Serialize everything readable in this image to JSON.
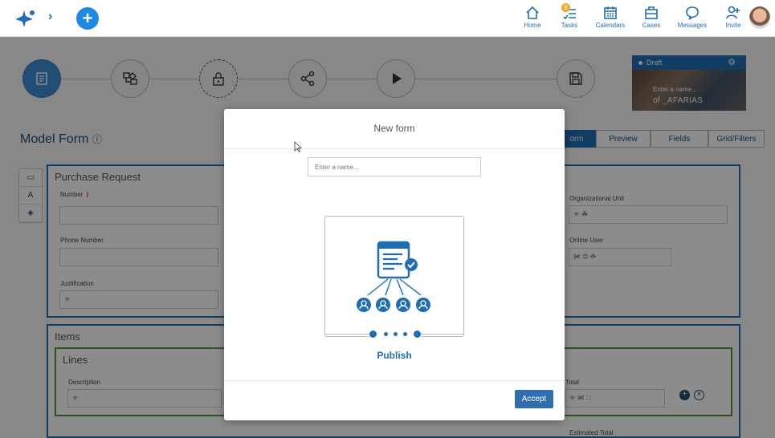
{
  "topbar": {
    "nav": [
      {
        "label": "Home",
        "icon": "home-icon"
      },
      {
        "label": "Tasks",
        "icon": "tasks-icon",
        "badge": "8"
      },
      {
        "label": "Calendars",
        "icon": "calendar-icon"
      },
      {
        "label": "Cases",
        "icon": "cases-icon"
      },
      {
        "label": "Messages",
        "icon": "messages-icon"
      },
      {
        "label": "Invite",
        "icon": "invite-icon"
      }
    ]
  },
  "draft_card": {
    "status": "Draft",
    "name_placeholder": "Enter a name...",
    "owner": "of _AFARIAS"
  },
  "page": {
    "title": "Model Form",
    "tabs": [
      "orm",
      "Preview",
      "Fields",
      "Grid/Filters"
    ]
  },
  "side_tools": [
    "▭",
    "A",
    "◈"
  ],
  "form": {
    "purchase_title": "Purchase Request",
    "fields_left": [
      "Number",
      "Phone Number",
      "Justification"
    ],
    "fields_right": [
      "Organizational Unit",
      "Online User"
    ],
    "items_title": "Items",
    "lines_title": "Lines",
    "description_label": "Description",
    "total_label": "Total",
    "estimated_total_label": "Estimated Total",
    "field_symbols": {
      "asterisk": "✳",
      "org_unit": "✳ ☘",
      "online_user": "✀ ◎ ☘",
      "total": "✳ ✀ ∷"
    }
  },
  "modal": {
    "title": "New form",
    "name_placeholder": "Enter a name...",
    "option_label": "Publish",
    "accept_label": "Accept"
  },
  "colors": {
    "accent": "#1f6db5",
    "lines_border": "#4a9a3a",
    "badge": "#f5a623"
  }
}
